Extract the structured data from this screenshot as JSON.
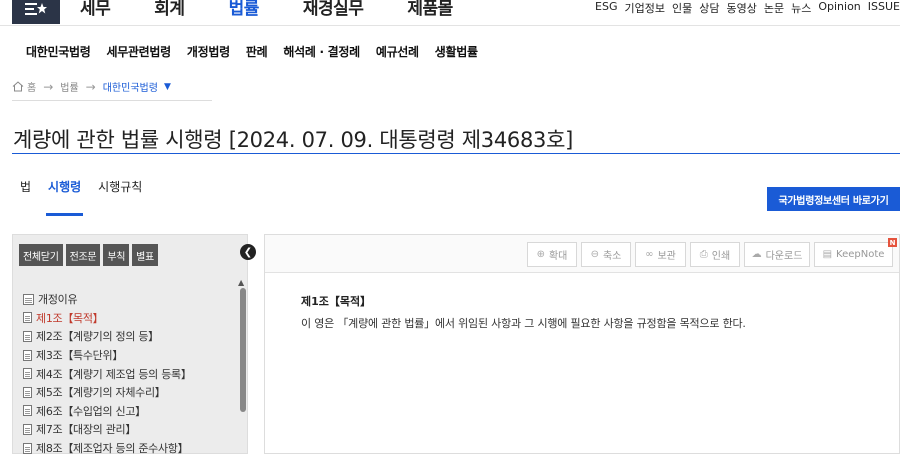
{
  "header": {
    "menu_icon": "menu-star-icon",
    "gnb": [
      "세무",
      "회계",
      "법률",
      "재경실무",
      "제품몰"
    ],
    "active_gnb": "법률",
    "utility": [
      "ESG",
      "기업정보",
      "인물",
      "상담",
      "동영상",
      "논문",
      "뉴스",
      "Opinion",
      "ISSUE"
    ]
  },
  "subnav": [
    "대한민국법령",
    "세무관련법령",
    "개정법령",
    "판례",
    "해석례 · 결정례",
    "예규선례",
    "생활법률"
  ],
  "breadcrumb": {
    "home": "홈",
    "level1": "법률",
    "current": "대한민국법령"
  },
  "page_title": "계량에 관한 법률 시행령 [2024. 07. 09. 대통령령 제34683호]",
  "tabs": [
    {
      "label": "법",
      "active": false
    },
    {
      "label": "시행령",
      "active": true
    },
    {
      "label": "시행규칙",
      "active": false
    }
  ],
  "center_button": "국가법령정보센터 바로가기",
  "left_panel": {
    "buttons": [
      "전체닫기",
      "전조문",
      "부칙",
      "별표"
    ],
    "toc": [
      {
        "label": "개정이유",
        "active": false
      },
      {
        "label": "제1조【목적】",
        "active": true
      },
      {
        "label": "제2조【계량기의 정의 등】",
        "active": false
      },
      {
        "label": "제3조【특수단위】",
        "active": false
      },
      {
        "label": "제4조【계량기 제조업 등의 등록】",
        "active": false
      },
      {
        "label": "제5조【계량기의 자체수리】",
        "active": false
      },
      {
        "label": "제6조【수입업의 신고】",
        "active": false
      },
      {
        "label": "제7조【대장의 관리】",
        "active": false
      },
      {
        "label": "제8조【제조업자 등의 준수사항】",
        "active": false
      }
    ]
  },
  "toolbar": {
    "zoom_in": "확대",
    "zoom_out": "축소",
    "save": "보관",
    "print": "인쇄",
    "download": "다운로드",
    "keepnote": "KeepNote",
    "badge": "N"
  },
  "article": {
    "title": "제1조【목적】",
    "body": "이 영은 「계량에 관한 법률」에서 위임된 사항과 그 시행에 필요한 사항을 규정함을 목적으로 한다."
  },
  "colors": {
    "accent": "#1a5bd6",
    "dark": "#2b3447",
    "active_item": "#c0392b"
  }
}
